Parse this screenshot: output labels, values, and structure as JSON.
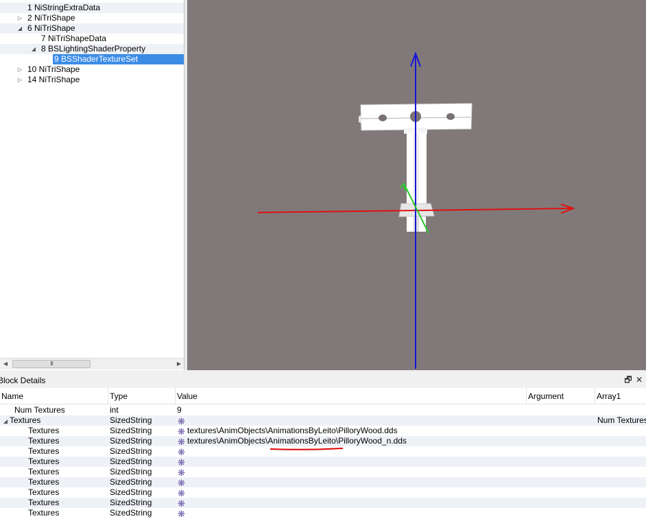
{
  "tree": {
    "items": [
      {
        "label": "1 NiStringExtraData",
        "arrow": ""
      },
      {
        "label": "2 NiTriShape",
        "arrow": "▷"
      },
      {
        "label": "6 NiTriShape",
        "arrow": "◢"
      },
      {
        "label": "7 NiTriShapeData",
        "arrow": ""
      },
      {
        "label": "8 BSLightingShaderProperty",
        "arrow": "◢"
      },
      {
        "label": "9 BSShaderTextureSet",
        "arrow": ""
      },
      {
        "label": "10 NiTriShape",
        "arrow": "▷"
      },
      {
        "label": "14 NiTriShape",
        "arrow": "▷"
      }
    ],
    "scroll_thumb": "III"
  },
  "viewport": {
    "background": "#817979",
    "axis_colors": {
      "x": "#e01010",
      "y": "#1414d8",
      "z": "#2ec82e"
    }
  },
  "details": {
    "title": "Block Details",
    "float_icon": "restore-icon",
    "close_icon": "close-icon",
    "columns": {
      "name": "Name",
      "type": "Type",
      "value": "Value",
      "argument": "Argument",
      "array1": "Array1"
    },
    "rows": [
      {
        "name": "Num Textures",
        "type": "int",
        "value": "9",
        "arg": "",
        "arr": "",
        "glyph": false,
        "expander": ""
      },
      {
        "name": "Textures",
        "type": "SizedString",
        "value": "",
        "arg": "",
        "arr": "Num Textures",
        "glyph": true,
        "expander": "◢"
      },
      {
        "name": "Textures",
        "type": "SizedString",
        "value": "textures\\AnimObjects\\AnimationsByLeito\\PilloryWood.dds",
        "arg": "",
        "arr": "",
        "glyph": true,
        "expander": ""
      },
      {
        "name": "Textures",
        "type": "SizedString",
        "value": "textures\\AnimObjects\\AnimationsByLeito\\PilloryWood_n.dds",
        "arg": "",
        "arr": "",
        "glyph": true,
        "expander": ""
      },
      {
        "name": "Textures",
        "type": "SizedString",
        "value": "",
        "arg": "",
        "arr": "",
        "glyph": true,
        "expander": ""
      },
      {
        "name": "Textures",
        "type": "SizedString",
        "value": "",
        "arg": "",
        "arr": "",
        "glyph": true,
        "expander": ""
      },
      {
        "name": "Textures",
        "type": "SizedString",
        "value": "",
        "arg": "",
        "arr": "",
        "glyph": true,
        "expander": ""
      },
      {
        "name": "Textures",
        "type": "SizedString",
        "value": "",
        "arg": "",
        "arr": "",
        "glyph": true,
        "expander": ""
      },
      {
        "name": "Textures",
        "type": "SizedString",
        "value": "",
        "arg": "",
        "arr": "",
        "glyph": true,
        "expander": ""
      },
      {
        "name": "Textures",
        "type": "SizedString",
        "value": "",
        "arg": "",
        "arr": "",
        "glyph": true,
        "expander": ""
      },
      {
        "name": "Textures",
        "type": "SizedString",
        "value": "",
        "arg": "",
        "arr": "",
        "glyph": true,
        "expander": ""
      }
    ],
    "annotation_color": "#e00000"
  }
}
